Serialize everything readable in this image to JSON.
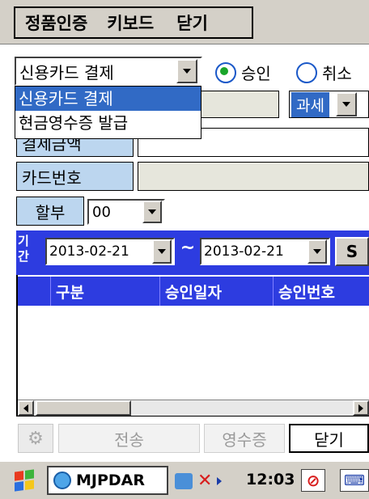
{
  "menu": {
    "items": [
      "정품인증",
      "키보드",
      "닫기"
    ]
  },
  "payment": {
    "selected": "신용카드 결제",
    "options": [
      "신용카드 결제",
      "현금영수증 발급"
    ],
    "radio_approve": "승인",
    "radio_cancel": "취소",
    "tax_value": "과세"
  },
  "form": {
    "amount_label": "결제금액",
    "card_label": "카드번호",
    "installment_label": "할부",
    "installment_value": "00"
  },
  "period": {
    "label": "기간",
    "from": "2013-02-21",
    "to": "2013-02-21",
    "tilde": "~",
    "search_label": "S"
  },
  "grid": {
    "columns": [
      "구분",
      "승인일자",
      "승인번호"
    ]
  },
  "actions": {
    "send": "전송",
    "receipt": "영수증",
    "close": "닫기"
  },
  "taskbar": {
    "app": "MJPDAR",
    "clock": "12:03"
  },
  "colors": {
    "header_blue": "#2d3ce0",
    "label_blue": "#bcd6ef",
    "select_blue": "#316ac5"
  }
}
